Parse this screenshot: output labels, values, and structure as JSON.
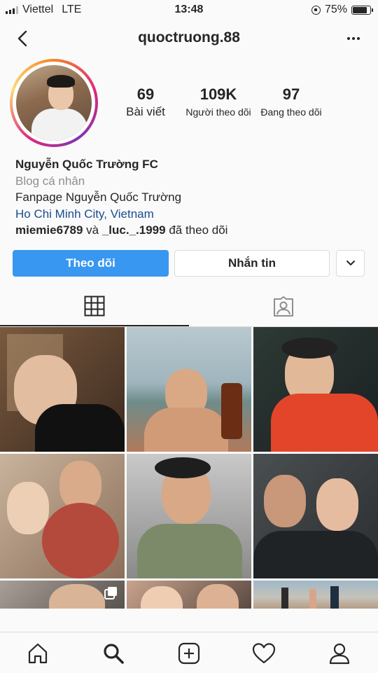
{
  "status_bar": {
    "carrier": "Viettel",
    "network": "LTE",
    "time": "13:48",
    "battery": "75%",
    "battery_level": 0.75
  },
  "header": {
    "username": "quoctruong.88"
  },
  "profile": {
    "stats": [
      {
        "value": "69",
        "label": "Bài viết"
      },
      {
        "value": "109K",
        "label": "Người theo dõi"
      },
      {
        "value": "97",
        "label": "Đang theo dõi"
      }
    ],
    "display_name": "Nguyễn Quốc Trường FC",
    "category": "Blog cá nhân",
    "bio": "Fanpage Nguyễn Quốc Trường",
    "location": "Ho Chi Minh City, Vietnam",
    "followed_by_1": "miemie6789",
    "followed_by_and": "và",
    "followed_by_2": "_luc._.1999",
    "followed_by_suffix": "đã theo dõi"
  },
  "actions": {
    "follow": "Theo dõi",
    "message": "Nhắn tin"
  },
  "tabs": [
    {
      "icon": "grid-icon",
      "active": true
    },
    {
      "icon": "tagged-icon",
      "active": false
    }
  ],
  "posts": [
    {
      "icon": "photo"
    },
    {
      "icon": "photo"
    },
    {
      "icon": "photo"
    },
    {
      "icon": "photo"
    },
    {
      "icon": "photo"
    },
    {
      "icon": "photo"
    },
    {
      "icon": "carousel"
    },
    {
      "icon": "photo"
    },
    {
      "icon": "photo"
    }
  ],
  "bottom_nav": [
    "home-icon",
    "search-icon",
    "add-icon",
    "heart-icon",
    "profile-icon"
  ],
  "colors": {
    "accent": "#3897f0",
    "link": "#1a4c8f",
    "muted": "#8e8e8e"
  }
}
